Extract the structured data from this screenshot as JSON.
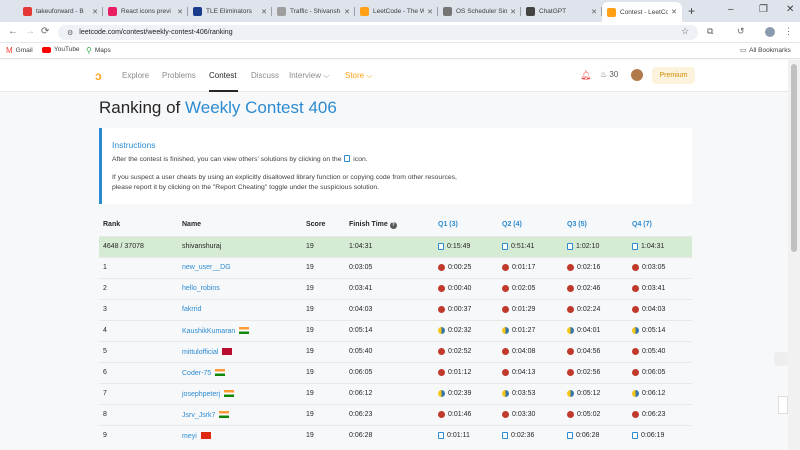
{
  "browser": {
    "tabs": [
      {
        "label": "takeuforward - B",
        "color": "#e53935"
      },
      {
        "label": "React icons previ",
        "color": "#e91e63"
      },
      {
        "label": "TLE Eliminators",
        "color": "#1a3c8c"
      },
      {
        "label": "Traffic - Shivansh",
        "color": "#9e9e9e"
      },
      {
        "label": "LeetCode - The W",
        "color": "#ffa116"
      },
      {
        "label": "OS Scheduler Sim",
        "color": "#757575"
      },
      {
        "label": "ChatGPT",
        "color": "#444444"
      },
      {
        "label": "Contest - LeetCo",
        "color": "#ffa116"
      }
    ],
    "url": "leetcode.com/contest/weekly-contest-406/ranking",
    "bookmarks": [
      "Gmail",
      "YouTube",
      "Maps"
    ],
    "all_bookmarks": "All Bookmarks"
  },
  "nav": {
    "links": [
      "Explore",
      "Problems",
      "Contest",
      "Discuss",
      "Interview ⌵",
      "Store ⌵"
    ],
    "streak": "30",
    "premium": "Premium"
  },
  "page": {
    "title_prefix": "Ranking of ",
    "title_contest": "Weekly Contest 406",
    "instructions_title": "Instructions",
    "instr_line1a": "After the contest is finished, you can view others' solutions by clicking on the",
    "instr_line1b": "icon.",
    "instr_line2": "If you suspect a user cheats by using an explicitly disallowed library function or copying code from other resources,",
    "instr_line3": "please report it by clicking on the \"Report Cheating\" toggle under the suspicious solution."
  },
  "table": {
    "headers": [
      "Rank",
      "Name",
      "Score",
      "Finish Time",
      "Q1 (3)",
      "Q2 (4)",
      "Q3 (5)",
      "Q4 (7)"
    ],
    "rows": [
      {
        "rank": "4648 / 37078",
        "name": "shivanshuraj",
        "score": "19",
        "finish": "1:04:31",
        "q": [
          "0:15:49",
          "0:51:41",
          "1:02:10",
          "1:04:31"
        ],
        "lang": [
          "file",
          "file",
          "file",
          "file"
        ],
        "flag": "",
        "me": true
      },
      {
        "rank": "1",
        "name": "new_user__DG",
        "score": "19",
        "finish": "0:03:05",
        "q": [
          "0:00:25",
          "0:01:17",
          "0:02:16",
          "0:03:05"
        ],
        "lang": [
          "cpp",
          "cpp",
          "cpp",
          "cpp"
        ],
        "flag": ""
      },
      {
        "rank": "2",
        "name": "hello_robins",
        "score": "19",
        "finish": "0:03:41",
        "q": [
          "0:00:40",
          "0:02:05",
          "0:02:46",
          "0:03:41"
        ],
        "lang": [
          "cpp",
          "cpp",
          "cpp",
          "cpp"
        ],
        "flag": ""
      },
      {
        "rank": "3",
        "name": "fakrrid",
        "score": "19",
        "finish": "0:04:03",
        "q": [
          "0:00:37",
          "0:01:29",
          "0:02:24",
          "0:04:03"
        ],
        "lang": [
          "cpp",
          "cpp",
          "cpp",
          "cpp"
        ],
        "flag": ""
      },
      {
        "rank": "4",
        "name": "KaushikKumaran",
        "score": "19",
        "finish": "0:05:14",
        "q": [
          "0:02:32",
          "0:01:27",
          "0:04:01",
          "0:05:14"
        ],
        "lang": [
          "py",
          "py",
          "py",
          "py"
        ],
        "flag": "IN"
      },
      {
        "rank": "5",
        "name": "mittulofficial",
        "score": "19",
        "finish": "0:05:40",
        "q": [
          "0:02:52",
          "0:04:08",
          "0:04:56",
          "0:05:40"
        ],
        "lang": [
          "cpp",
          "cpp",
          "cpp",
          "cpp"
        ],
        "flag": "NO"
      },
      {
        "rank": "6",
        "name": "Coder-75",
        "score": "19",
        "finish": "0:06:05",
        "q": [
          "0:01:12",
          "0:04:13",
          "0:02:56",
          "0:06:05"
        ],
        "lang": [
          "cpp",
          "cpp",
          "cpp",
          "cpp"
        ],
        "flag": "IN"
      },
      {
        "rank": "7",
        "name": "josephpeterj",
        "score": "19",
        "finish": "0:06:12",
        "q": [
          "0:02:39",
          "0:03:53",
          "0:05:12",
          "0:06:12"
        ],
        "lang": [
          "py",
          "py",
          "py",
          "py"
        ],
        "flag": "IN"
      },
      {
        "rank": "8",
        "name": "Jsrv_Jsrk7",
        "score": "19",
        "finish": "0:06:23",
        "q": [
          "0:01:46",
          "0:03:30",
          "0:05:02",
          "0:06:23"
        ],
        "lang": [
          "cpp",
          "cpp",
          "cpp",
          "cpp"
        ],
        "flag": "IN"
      },
      {
        "rank": "9",
        "name": "meyi",
        "score": "19",
        "finish": "0:06:28",
        "q": [
          "0:01:11",
          "0:02:36",
          "0:06:28",
          "0:06:19"
        ],
        "lang": [
          "file",
          "file",
          "file",
          "file"
        ],
        "flag": "CN"
      }
    ]
  }
}
